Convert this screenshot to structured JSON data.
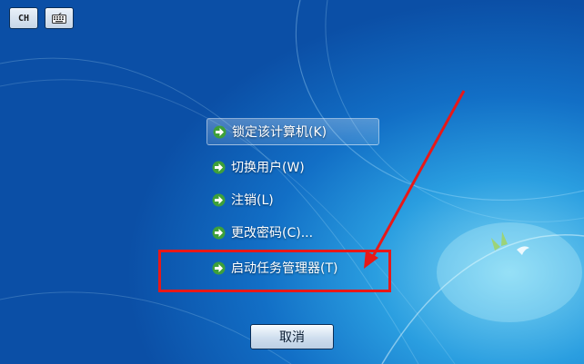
{
  "topbar": {
    "language_label": "CH",
    "keyboard_icon": "keyboard-icon"
  },
  "menu": {
    "items": [
      {
        "label": "锁定该计算机(K)"
      },
      {
        "label": "切换用户(W)"
      },
      {
        "label": "注销(L)"
      },
      {
        "label": "更改密码(C)..."
      },
      {
        "label": "启动任务管理器(T)"
      }
    ],
    "item_icon": "green-arrow-icon"
  },
  "annotation": {
    "box_color": "#e81818",
    "arrow_color": "#e81818"
  },
  "footer": {
    "cancel_label": "取消"
  },
  "colors": {
    "background_accent": "#126fc6",
    "text": "#ffffff"
  }
}
